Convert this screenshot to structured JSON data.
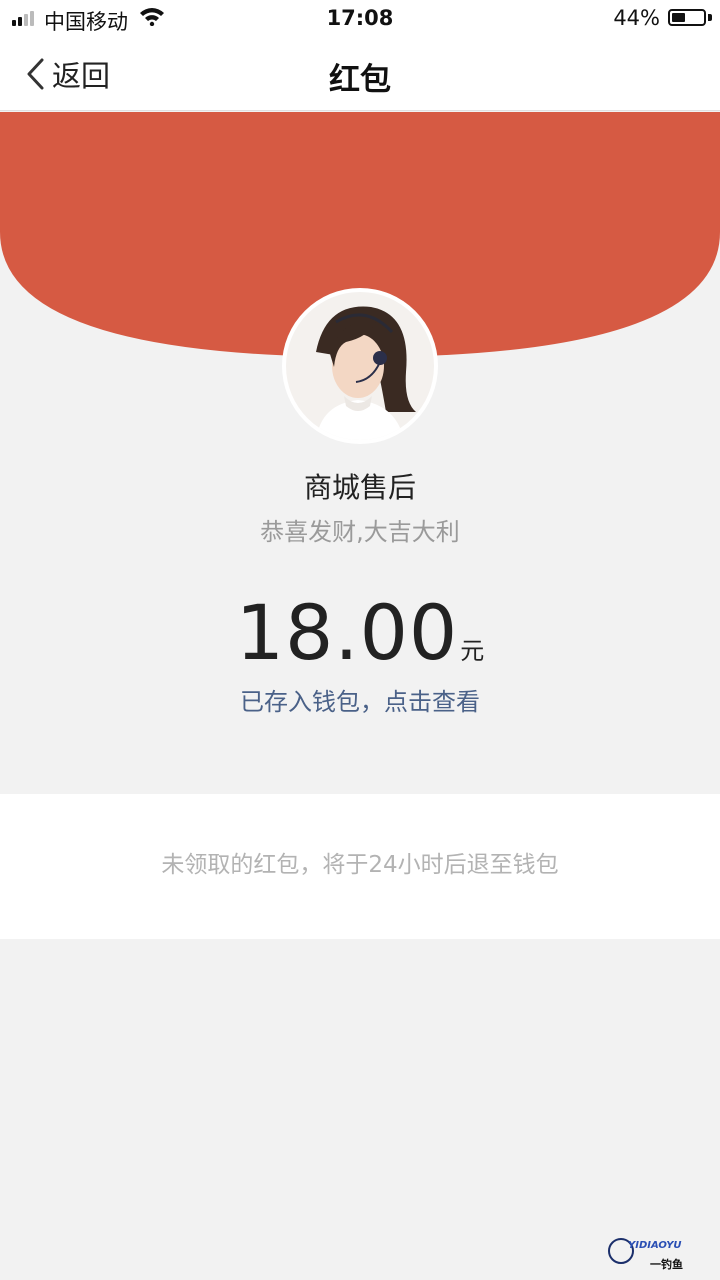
{
  "status_bar": {
    "carrier": "中国移动",
    "time": "17:08",
    "battery_percent": "44%",
    "battery_level": 0.44,
    "signal_bars_filled": 2,
    "signal_bars_total": 4
  },
  "nav": {
    "back_label": "返回",
    "title": "红包"
  },
  "red_packet": {
    "sender_name": "商城售后",
    "wish": "恭喜发财,大吉大利",
    "amount": "18.00",
    "currency_unit": "元",
    "wallet_link": "已存入钱包，点击查看",
    "notice": "未领取的红包，将于24小时后退至钱包"
  },
  "watermark": {
    "text": "YIDIAOYU",
    "sub": "一钓鱼"
  },
  "colors": {
    "header_red": "#d65a43",
    "link_blue": "#4a6188",
    "page_bg": "#f2f2f2"
  },
  "icons": {
    "back": "chevron-left-icon",
    "wifi": "wifi-icon",
    "battery": "battery-icon",
    "signal": "signal-icon"
  }
}
